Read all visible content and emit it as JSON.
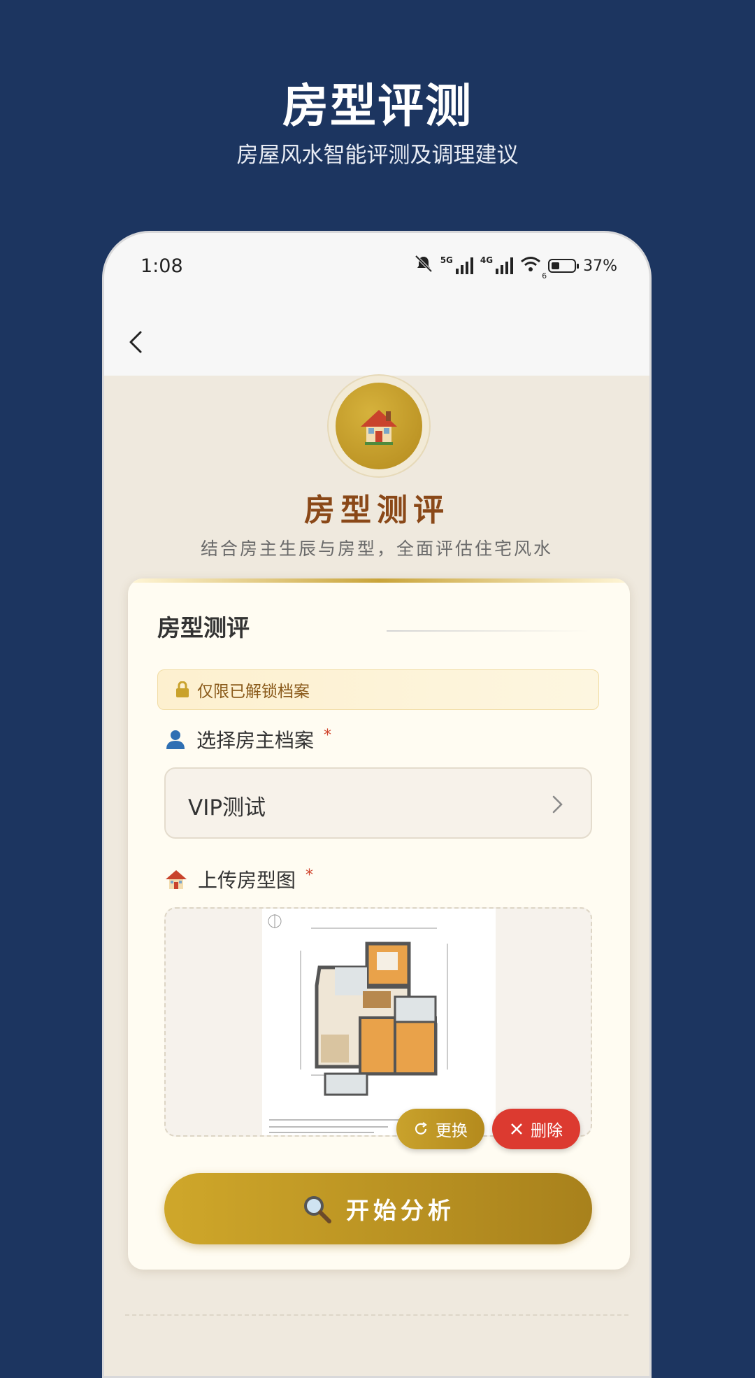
{
  "promo": {
    "title": "房型评测",
    "subtitle": "房屋风水智能评测及调理建议"
  },
  "statusbar": {
    "time": "1:08",
    "net1": "5G",
    "net2": "4G",
    "wifi_badge": "6",
    "battery_percent": "37%",
    "battery_level": 0.37
  },
  "hero": {
    "icon": "house-icon",
    "title": "房型测评",
    "subtitle": "结合房主生辰与房型，全面评估住宅风水"
  },
  "card": {
    "title": "房型测评",
    "notice": "仅限已解锁档案",
    "owner_label": "选择房主档案",
    "required_mark": "*",
    "owner_value": "VIP测试",
    "upload_label": "上传房型图",
    "change_label": "更换",
    "delete_label": "删除",
    "analyze_label": "开始分析"
  },
  "colors": {
    "background": "#1c3560",
    "accent_gold": "#c9a22c",
    "title_brown": "#8a4818",
    "danger_red": "#dc3a30"
  }
}
